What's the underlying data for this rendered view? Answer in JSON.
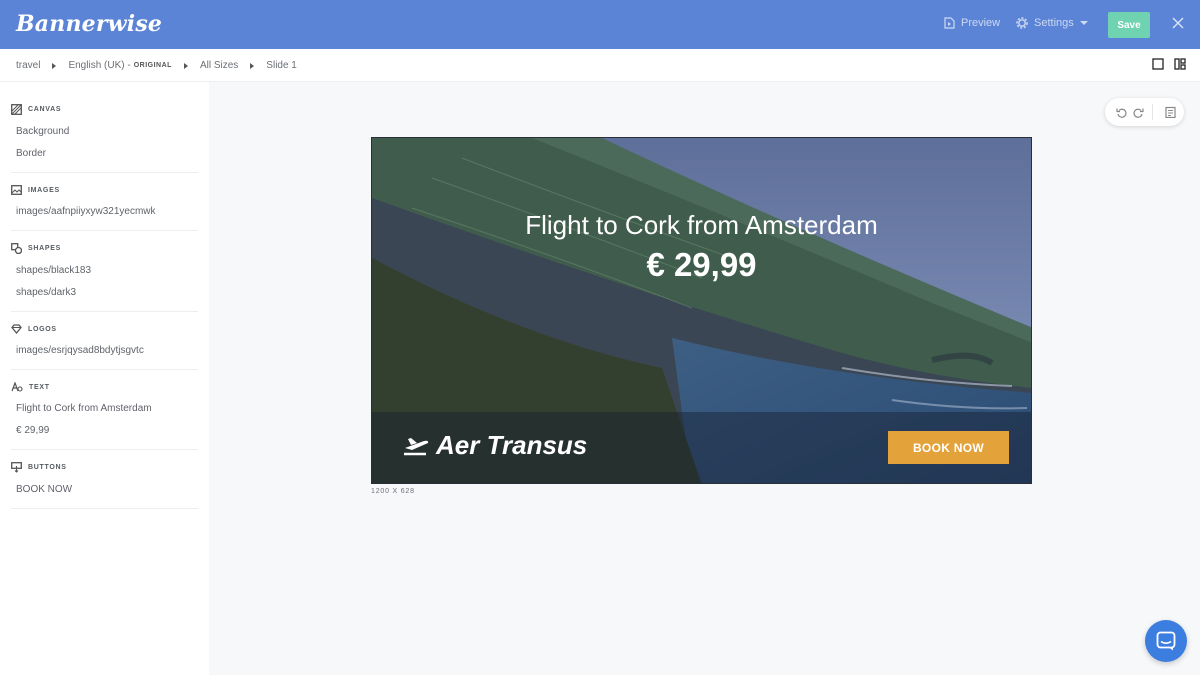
{
  "app": {
    "logo_text": "Bannerwise"
  },
  "topbar": {
    "preview_label": "Preview",
    "settings_label": "Settings",
    "save_label": "Save"
  },
  "breadcrumb": {
    "items": [
      "travel",
      "English (UK) -",
      "All Sizes",
      "Slide 1"
    ],
    "original_badge": "ORIGINAL"
  },
  "sidebar": {
    "sections": [
      {
        "title": "CANVAS",
        "icon": "canvas-icon",
        "items": [
          "Background",
          "Border"
        ]
      },
      {
        "title": "IMAGES",
        "icon": "image-icon",
        "items": [
          "images/aafnpiiyxyw321yecmwk"
        ]
      },
      {
        "title": "SHAPES",
        "icon": "shapes-icon",
        "items": [
          "shapes/black183",
          "shapes/dark3"
        ]
      },
      {
        "title": "LOGOS",
        "icon": "diamond-icon",
        "items": [
          "images/esrjqysad8bdytjsgvtc"
        ]
      },
      {
        "title": "TEXT",
        "icon": "text-icon",
        "items": [
          "Flight to Cork from Amsterdam",
          "€ 29,99"
        ]
      },
      {
        "title": "BUTTONS",
        "icon": "button-icon",
        "items": [
          "BOOK NOW"
        ]
      }
    ]
  },
  "banner": {
    "headline": "Flight to Cork from Amsterdam",
    "price": "€ 29,99",
    "brand": "Aer Transus",
    "cta": "BOOK NOW",
    "size_label": "1200 X 628"
  },
  "colors": {
    "topbar": "#5b84d6",
    "save_button": "#6fd3b1",
    "cta_button": "#e3a23a",
    "chat_button": "#3c7de0"
  }
}
